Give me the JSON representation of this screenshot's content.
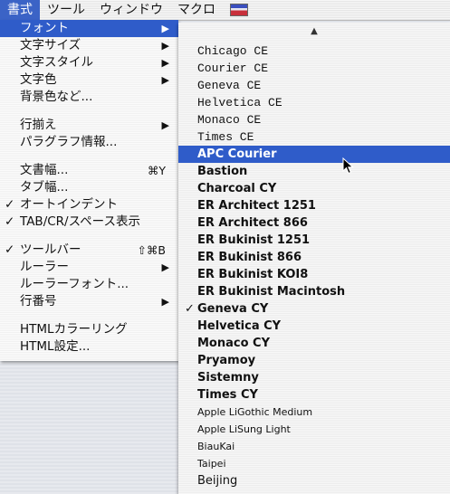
{
  "menubar": {
    "items": [
      "書式",
      "ツール",
      "ウィンドウ",
      "マクロ"
    ],
    "active_index": 0,
    "flag_icon": "russia-flag-icon"
  },
  "menu": {
    "items": [
      {
        "label": "フォント",
        "submenu": true,
        "selected": true
      },
      {
        "label": "文字サイズ",
        "submenu": true
      },
      {
        "label": "文字スタイル",
        "submenu": true
      },
      {
        "label": "文字色",
        "submenu": true
      },
      {
        "label": "背景色など..."
      },
      {
        "label": "行揃え",
        "submenu": true
      },
      {
        "label": "パラグラフ情報..."
      },
      {
        "label": "文書幅...",
        "shortcut": "⌘Y"
      },
      {
        "label": "タブ幅..."
      },
      {
        "label": "オートインデント",
        "checked": true
      },
      {
        "label": "TAB/CR/スペース表示",
        "checked": true
      },
      {
        "label": "ツールバー",
        "checked": true,
        "shortcut": "⇧⌘B"
      },
      {
        "label": "ルーラー",
        "submenu": true
      },
      {
        "label": "ルーラーフォント..."
      },
      {
        "label": "行番号",
        "submenu": true
      },
      {
        "label": "HTMLカラーリング"
      },
      {
        "label": "HTML設定..."
      }
    ],
    "check_glyph": "✓",
    "arrow_glyph": "▶"
  },
  "fonts": {
    "scroll_arrow": "▲",
    "items": [
      {
        "label": "Chicago CE",
        "style": "mono"
      },
      {
        "label": "Courier CE",
        "style": "mono"
      },
      {
        "label": "Geneva CE",
        "style": "mono"
      },
      {
        "label": "Helvetica CE",
        "style": "mono"
      },
      {
        "label": "Monaco CE",
        "style": "mono"
      },
      {
        "label": "Times CE",
        "style": "mono"
      },
      {
        "label": "APC Courier",
        "style": "bold",
        "selected": true
      },
      {
        "label": "Bastion",
        "style": "bold"
      },
      {
        "label": "Charcoal CY",
        "style": "bold"
      },
      {
        "label": "ER Architect 1251",
        "style": "bold"
      },
      {
        "label": "ER Architect 866",
        "style": "bold"
      },
      {
        "label": "ER Bukinist 1251",
        "style": "bold"
      },
      {
        "label": "ER Bukinist 866",
        "style": "bold"
      },
      {
        "label": "ER Bukinist KOI8",
        "style": "bold"
      },
      {
        "label": "ER Bukinist Macintosh",
        "style": "bold"
      },
      {
        "label": "Geneva CY",
        "style": "bold",
        "checked": true
      },
      {
        "label": "Helvetica CY",
        "style": "bold"
      },
      {
        "label": "Monaco CY",
        "style": "bold"
      },
      {
        "label": "Pryamoy",
        "style": "bold"
      },
      {
        "label": "Sistemny",
        "style": "bold"
      },
      {
        "label": "Times CY",
        "style": "bold"
      },
      {
        "label": "Apple LiGothic Medium",
        "style": "small"
      },
      {
        "label": "Apple LiSung Light",
        "style": "small"
      },
      {
        "label": "BiauKai",
        "style": "small"
      },
      {
        "label": "Taipei",
        "style": "small"
      },
      {
        "label": "Beijing",
        "style": "normal"
      }
    ]
  },
  "colors": {
    "selection": "#2f5cc9",
    "menu_bg": "#f4f4f4"
  }
}
